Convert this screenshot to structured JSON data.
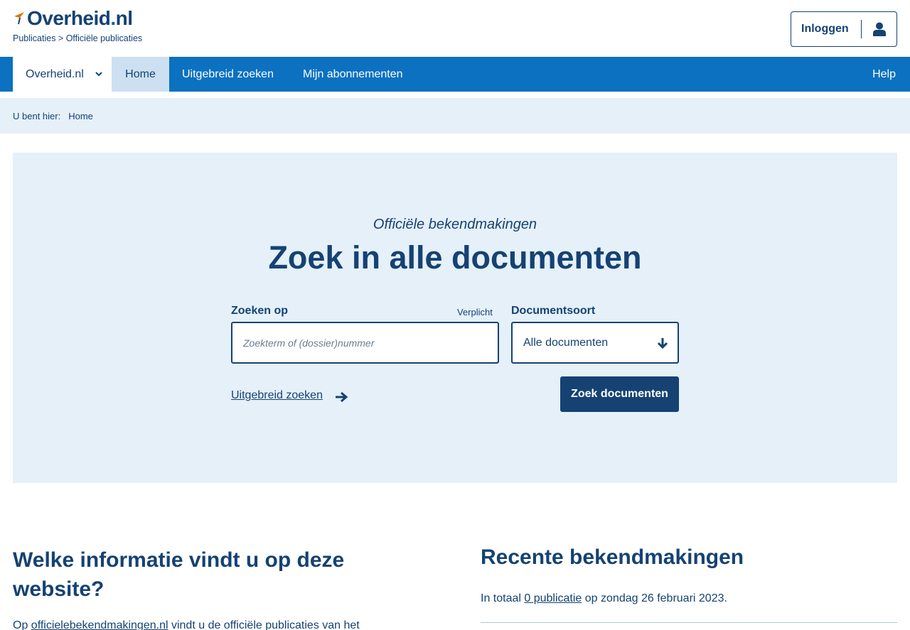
{
  "header": {
    "logo_text": "Overheid",
    "logo_dot": ".",
    "logo_suffix": "nl",
    "logo_sub": "Publicaties > Officiële publicaties",
    "login_label": "Inloggen"
  },
  "nav": {
    "items": [
      {
        "label": "Overheid.nl"
      },
      {
        "label": "Home"
      },
      {
        "label": "Uitgebreid zoeken"
      },
      {
        "label": "Mijn abonnementen"
      }
    ],
    "help": "Help"
  },
  "breadcrumb": {
    "prefix": "U bent hier:",
    "current": "Home"
  },
  "search": {
    "kicker": "Officiële bekendmakingen",
    "title": "Zoek in alle documenten",
    "field_label": "Zoeken op",
    "required": "Verplicht",
    "placeholder": "Zoekterm of (dossier)nummer",
    "value": "",
    "doc_type_label": "Documentsoort",
    "doc_type_selected": "Alle documenten",
    "advanced_link": "Uitgebreid zoeken",
    "submit": "Zoek documenten"
  },
  "info": {
    "title": "Welke informatie vindt u op deze website?",
    "text_prefix": "Op ",
    "text_link": "officielebekendmakingen.nl",
    "text_suffix": " vindt u de officiële publicaties van het"
  },
  "recent": {
    "title": "Recente bekendmakingen",
    "prefix": "In totaal ",
    "count_link": "0 publicatie",
    "suffix": " op zondag 26 februari 2023."
  },
  "colors": {
    "brand_dark": "#154273",
    "nav_blue": "#0b71c0",
    "panel_bg": "#e5f0f9",
    "logo_accent": "#e17000"
  }
}
